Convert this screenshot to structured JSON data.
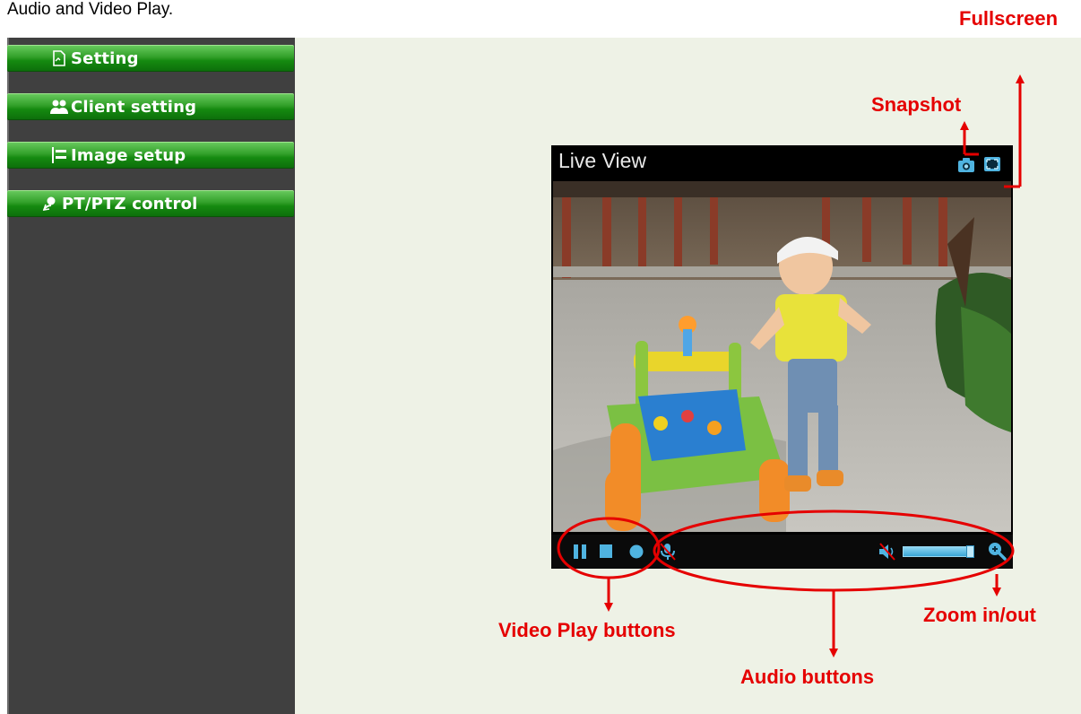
{
  "intro": "Audio and Video Play.",
  "sidebar": {
    "items": [
      {
        "label": "Setting",
        "icon": "document-icon"
      },
      {
        "label": "Client setting",
        "icon": "users-icon"
      },
      {
        "label": "Image setup",
        "icon": "image-setup-icon"
      },
      {
        "label": "PT/PTZ control",
        "icon": "ptz-icon"
      }
    ]
  },
  "live_view": {
    "title": "Live View",
    "top_icons": [
      "camera-icon",
      "fullscreen-icon"
    ],
    "controls": [
      "pause-icon",
      "stop-icon",
      "record-icon",
      "microphone-muted-icon",
      "speaker-muted-icon",
      "volume-slider",
      "zoom-icon"
    ]
  },
  "annotations": {
    "fullscreen": "Fullscreen",
    "snapshot": "Snapshot",
    "video_play": "Video Play buttons",
    "audio": "Audio buttons",
    "zoom": "Zoom in/out"
  },
  "colors": {
    "annotation_red": "#e50000",
    "sidebar_bg": "#404040",
    "button_green": "#158a10",
    "main_bg": "#eef2e6",
    "control_blue": "#4fb3e0"
  }
}
